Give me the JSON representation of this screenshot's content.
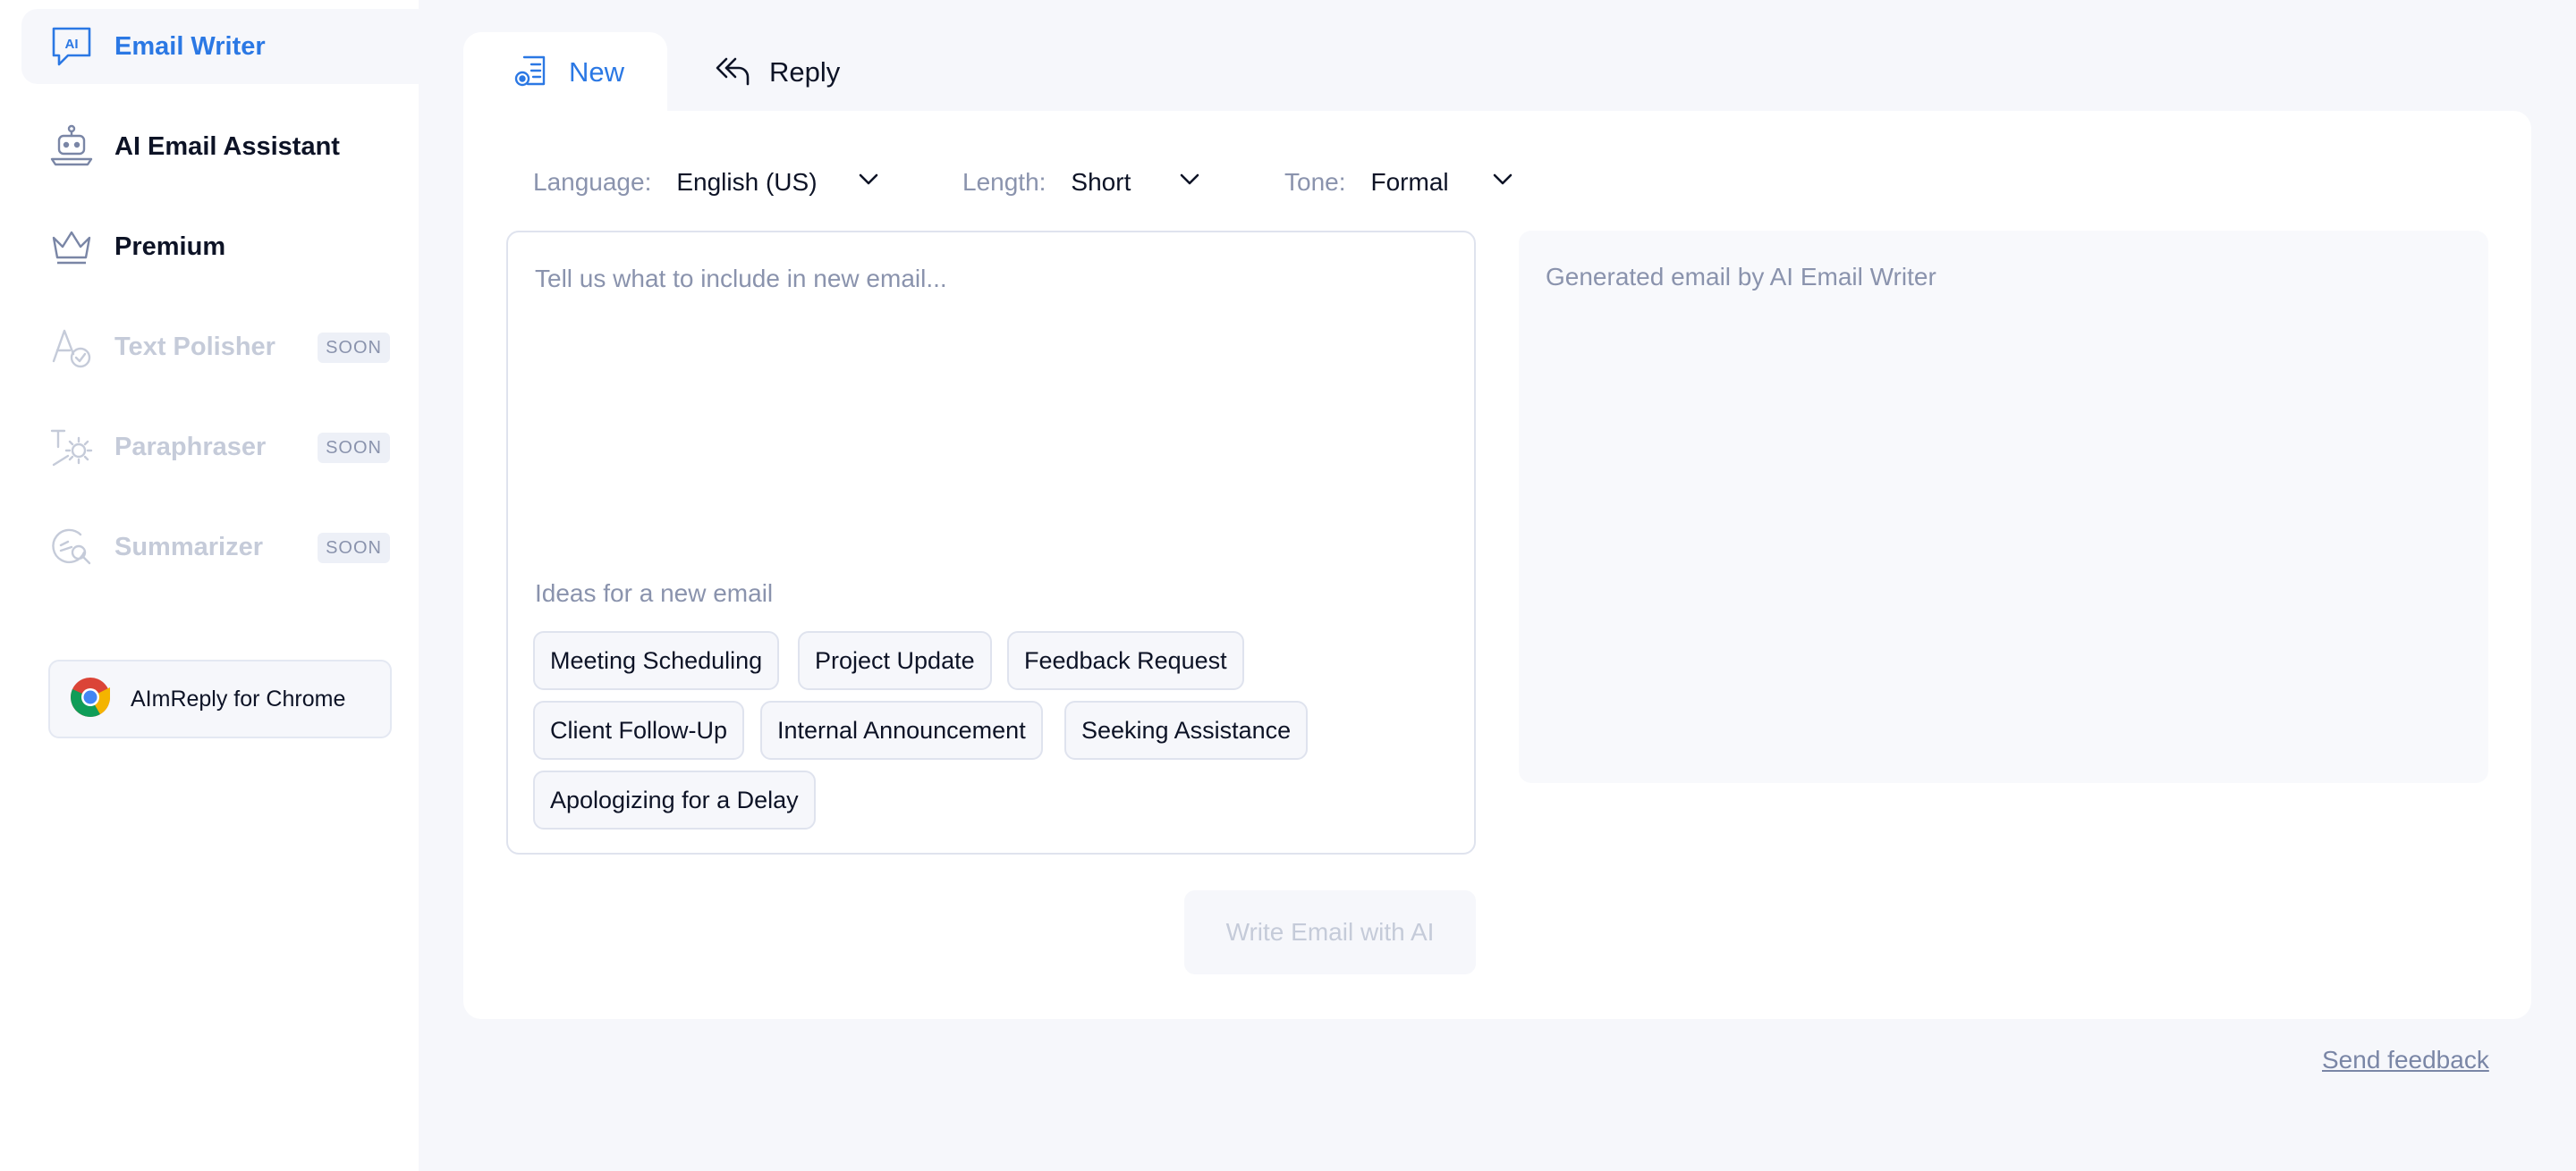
{
  "sidebar": {
    "items": [
      {
        "label": "Email Writer",
        "icon": "ai-chat-icon",
        "state": "active"
      },
      {
        "label": "AI Email Assistant",
        "icon": "robot-laptop-icon",
        "state": "normal"
      },
      {
        "label": "Premium",
        "icon": "crown-icon",
        "state": "normal"
      },
      {
        "label": "Text Polisher",
        "icon": "text-check-icon",
        "state": "disabled",
        "badge": "SOON"
      },
      {
        "label": "Paraphraser",
        "icon": "text-sparkle-icon",
        "state": "disabled",
        "badge": "SOON"
      },
      {
        "label": "Summarizer",
        "icon": "summarize-icon",
        "state": "disabled",
        "badge": "SOON"
      }
    ],
    "chrome_label": "AImReply for Chrome"
  },
  "tabs": [
    {
      "label": "New",
      "icon": "compose-icon",
      "active": true
    },
    {
      "label": "Reply",
      "icon": "reply-all-icon",
      "active": false
    }
  ],
  "options": {
    "language": {
      "label": "Language:",
      "value": "English (US)"
    },
    "length": {
      "label": "Length:",
      "value": "Short"
    },
    "tone": {
      "label": "Tone:",
      "value": "Formal"
    }
  },
  "input": {
    "placeholder": "Tell us what to include in new email...",
    "ideas_title": "Ideas for a new email",
    "ideas": [
      "Meeting Scheduling",
      "Project Update",
      "Feedback Request",
      "Client Follow-Up",
      "Internal Announcement",
      "Seeking Assistance",
      "Apologizing for a Delay"
    ]
  },
  "output": {
    "placeholder": "Generated email by AI Email Writer"
  },
  "write_button": "Write Email with AI",
  "feedback_link": "Send feedback",
  "colors": {
    "accent": "#2b78e4",
    "text": "#0d1326",
    "muted": "#8a93ad",
    "disabled": "#c5cbd9",
    "background": "#f6f7fb"
  }
}
